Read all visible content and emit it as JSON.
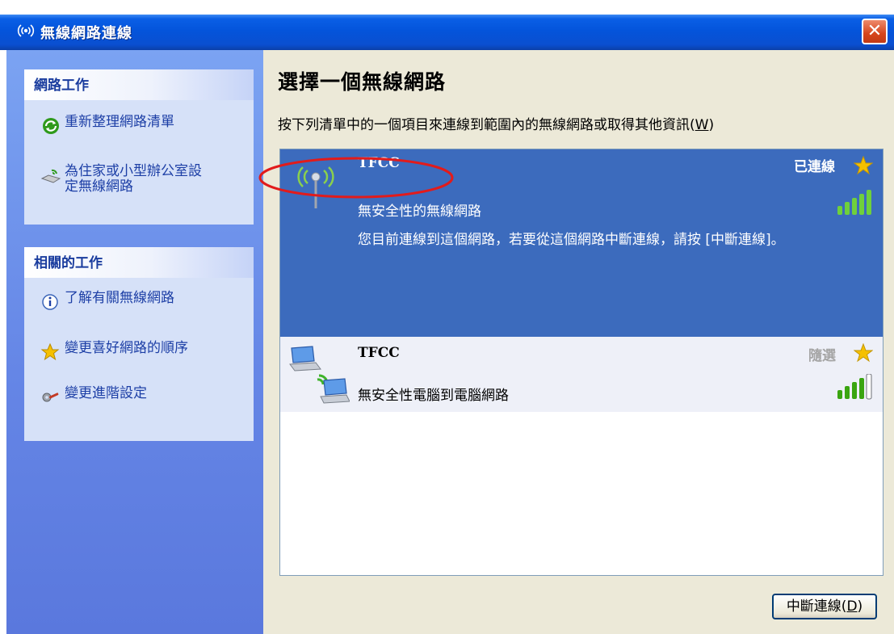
{
  "window": {
    "title": "無線網路連線",
    "close_label": "✕"
  },
  "sidebar": {
    "network_tasks": {
      "title": "網路工作",
      "items": [
        {
          "label": "重新整理網路清單",
          "icon": "refresh-icon"
        },
        {
          "label": "為住家或小型辦公室設\n定無線網路",
          "icon": "home-office-setup-icon"
        }
      ]
    },
    "related_tasks": {
      "title": "相關的工作",
      "items": [
        {
          "label": "了解有關無線網路",
          "icon": "info-icon"
        },
        {
          "label": "變更喜好網路的順序",
          "icon": "star-icon"
        },
        {
          "label": "變更進階設定",
          "icon": "settings-icon"
        }
      ]
    }
  },
  "main": {
    "heading": "選擇一個無線網路",
    "instruction": "按下列清單中的一個項目來連線到範圍內的無線網路或取得其他資訊(",
    "instruction_mnemonic": "W",
    "instruction_close": ")",
    "networks": [
      {
        "ssid": "TFCC",
        "status": "已連線",
        "security": "無安全性的無線網路",
        "message": "您目前連線到這個網路，若要從這個網路中斷連線，請按 [中斷連線]。",
        "signal_bars": 5,
        "selected": true,
        "icon": "wireless-antenna-icon"
      },
      {
        "ssid": "TFCC",
        "status": "隨選",
        "security": "無安全性電腦到電腦網路",
        "signal_bars": 4,
        "selected": false,
        "icon": "computer-to-computer-icon"
      }
    ],
    "disconnect_label": "中斷連線(",
    "disconnect_mnemonic": "D",
    "disconnect_close": ")"
  },
  "colors": {
    "title_bar": "#0454db",
    "sidebar": "#6586e6",
    "selected_row": "#3c6bbd",
    "annotation": "#e21b1b",
    "star": "#f5c000",
    "signal": "#3aa510"
  }
}
